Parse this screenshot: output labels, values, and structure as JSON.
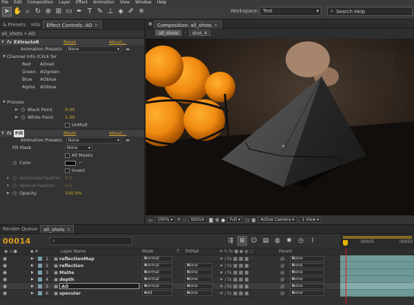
{
  "menubar": [
    "File",
    "Edit",
    "Composition",
    "Layer",
    "Effect",
    "Animation",
    "View",
    "Window",
    "Help"
  ],
  "workspace": {
    "label": "Workspace:",
    "value": "Test",
    "search_placeholder": "Search Help"
  },
  "left_panel": {
    "tabs": [
      {
        "label": "& Presets",
        "active": false
      },
      {
        "label": "Info",
        "active": false
      },
      {
        "label": "Effect Controls: AO",
        "active": true
      }
    ],
    "breadcrumb": "all_shots • AO",
    "extractor": {
      "name": "EXtractoR",
      "reset": "Reset",
      "about": "About...",
      "presets_label": "Animation Presets:",
      "presets_value": "None",
      "channel_info": "Channel Info (Click for",
      "channels": [
        {
          "label": "Red",
          "value": "AOred"
        },
        {
          "label": "Green",
          "value": "AOgreen"
        },
        {
          "label": "Blue",
          "value": "AOblue"
        },
        {
          "label": "Alpha",
          "value": "AOblue"
        }
      ],
      "process_label": "Process",
      "black_point_label": "Black Point",
      "black_point": "0.00",
      "white_point_label": "White Point",
      "white_point": "1.00",
      "unmult_label": "UnMult"
    },
    "fill": {
      "name": "Fill",
      "reset": "Reset",
      "about": "About...",
      "presets_label": "Animation Presets:",
      "presets_value": "None",
      "fill_mask_label": "Fill Mask",
      "fill_mask_value": "None",
      "all_masks_label": "All Masks",
      "color_label": "Color",
      "invert_label": "Invert",
      "h_feather_label": "Horizontal Feather",
      "h_feather": "0.0",
      "v_feather_label": "Vertical Feather",
      "v_feather": "0.0",
      "opacity_label": "Opacity",
      "opacity": "100.0%"
    }
  },
  "comp_panel": {
    "tab": "Composition: all_shots",
    "sub_tabs": [
      {
        "label": "all_shots",
        "active": true
      },
      {
        "label": "shot_4",
        "active": false
      }
    ],
    "zoom": "100%",
    "timecode": "00014",
    "resolution": "Full",
    "camera": "Active Camera",
    "views": "1 View"
  },
  "timeline": {
    "tabs": [
      {
        "label": "Render Queue",
        "active": false
      },
      {
        "label": "all_shots",
        "active": true
      }
    ],
    "timecode": "00014",
    "ruler_ticks": [
      "00025",
      "00050"
    ],
    "columns": {
      "name": "Layer Name",
      "mode": "Mode",
      "trkmat": "TrkMat",
      "parent": "Parent"
    },
    "layers": [
      {
        "num": "1",
        "name": "reflectionMap",
        "mode": "Normal",
        "trkmat": "",
        "parent": "None",
        "selected": false
      },
      {
        "num": "2",
        "name": "reflection",
        "mode": "Normal",
        "trkmat": "None",
        "parent": "None",
        "selected": false
      },
      {
        "num": "3",
        "name": "Matte",
        "mode": "Normal",
        "trkmat": "None",
        "parent": "None",
        "selected": false
      },
      {
        "num": "4",
        "name": "depth",
        "mode": "Normal",
        "trkmat": "None",
        "parent": "None",
        "selected": false
      },
      {
        "num": "5",
        "name": "AO",
        "mode": "Normal",
        "trkmat": "None",
        "parent": "None",
        "selected": true
      },
      {
        "num": "6",
        "name": "specular",
        "mode": "Add",
        "trkmat": "None",
        "parent": "None",
        "selected": false
      }
    ]
  }
}
